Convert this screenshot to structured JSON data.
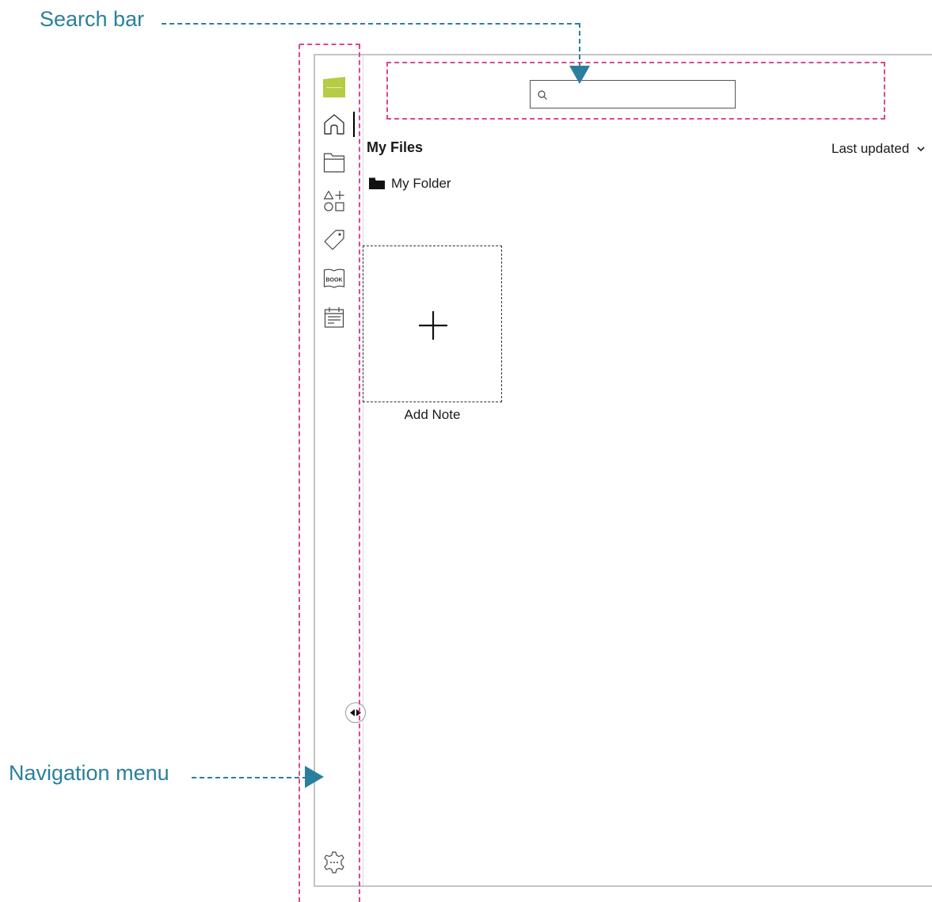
{
  "callouts": {
    "search_bar": "Search bar",
    "navigation_menu": "Navigation menu",
    "color": "#2a7f9e",
    "region_color": "#d9488f"
  },
  "sidebar": {
    "items": [
      {
        "icon": "app-logo-icon",
        "label": ""
      },
      {
        "icon": "home-icon",
        "label": "",
        "active": true
      },
      {
        "icon": "folder-icon",
        "label": ""
      },
      {
        "icon": "shapes-icon",
        "label": ""
      },
      {
        "icon": "tag-icon",
        "label": ""
      },
      {
        "icon": "book-icon",
        "label": "BOOK"
      },
      {
        "icon": "calendar-icon",
        "label": ""
      },
      {
        "icon": "settings-icon",
        "label": ""
      }
    ],
    "logo_color": "#b5cc44"
  },
  "search": {
    "value": "",
    "placeholder": ""
  },
  "main": {
    "title": "My Files",
    "sort": {
      "label": "Last updated"
    },
    "folders": [
      {
        "name": "My Folder"
      }
    ],
    "add_note": {
      "label": "Add Note"
    }
  }
}
